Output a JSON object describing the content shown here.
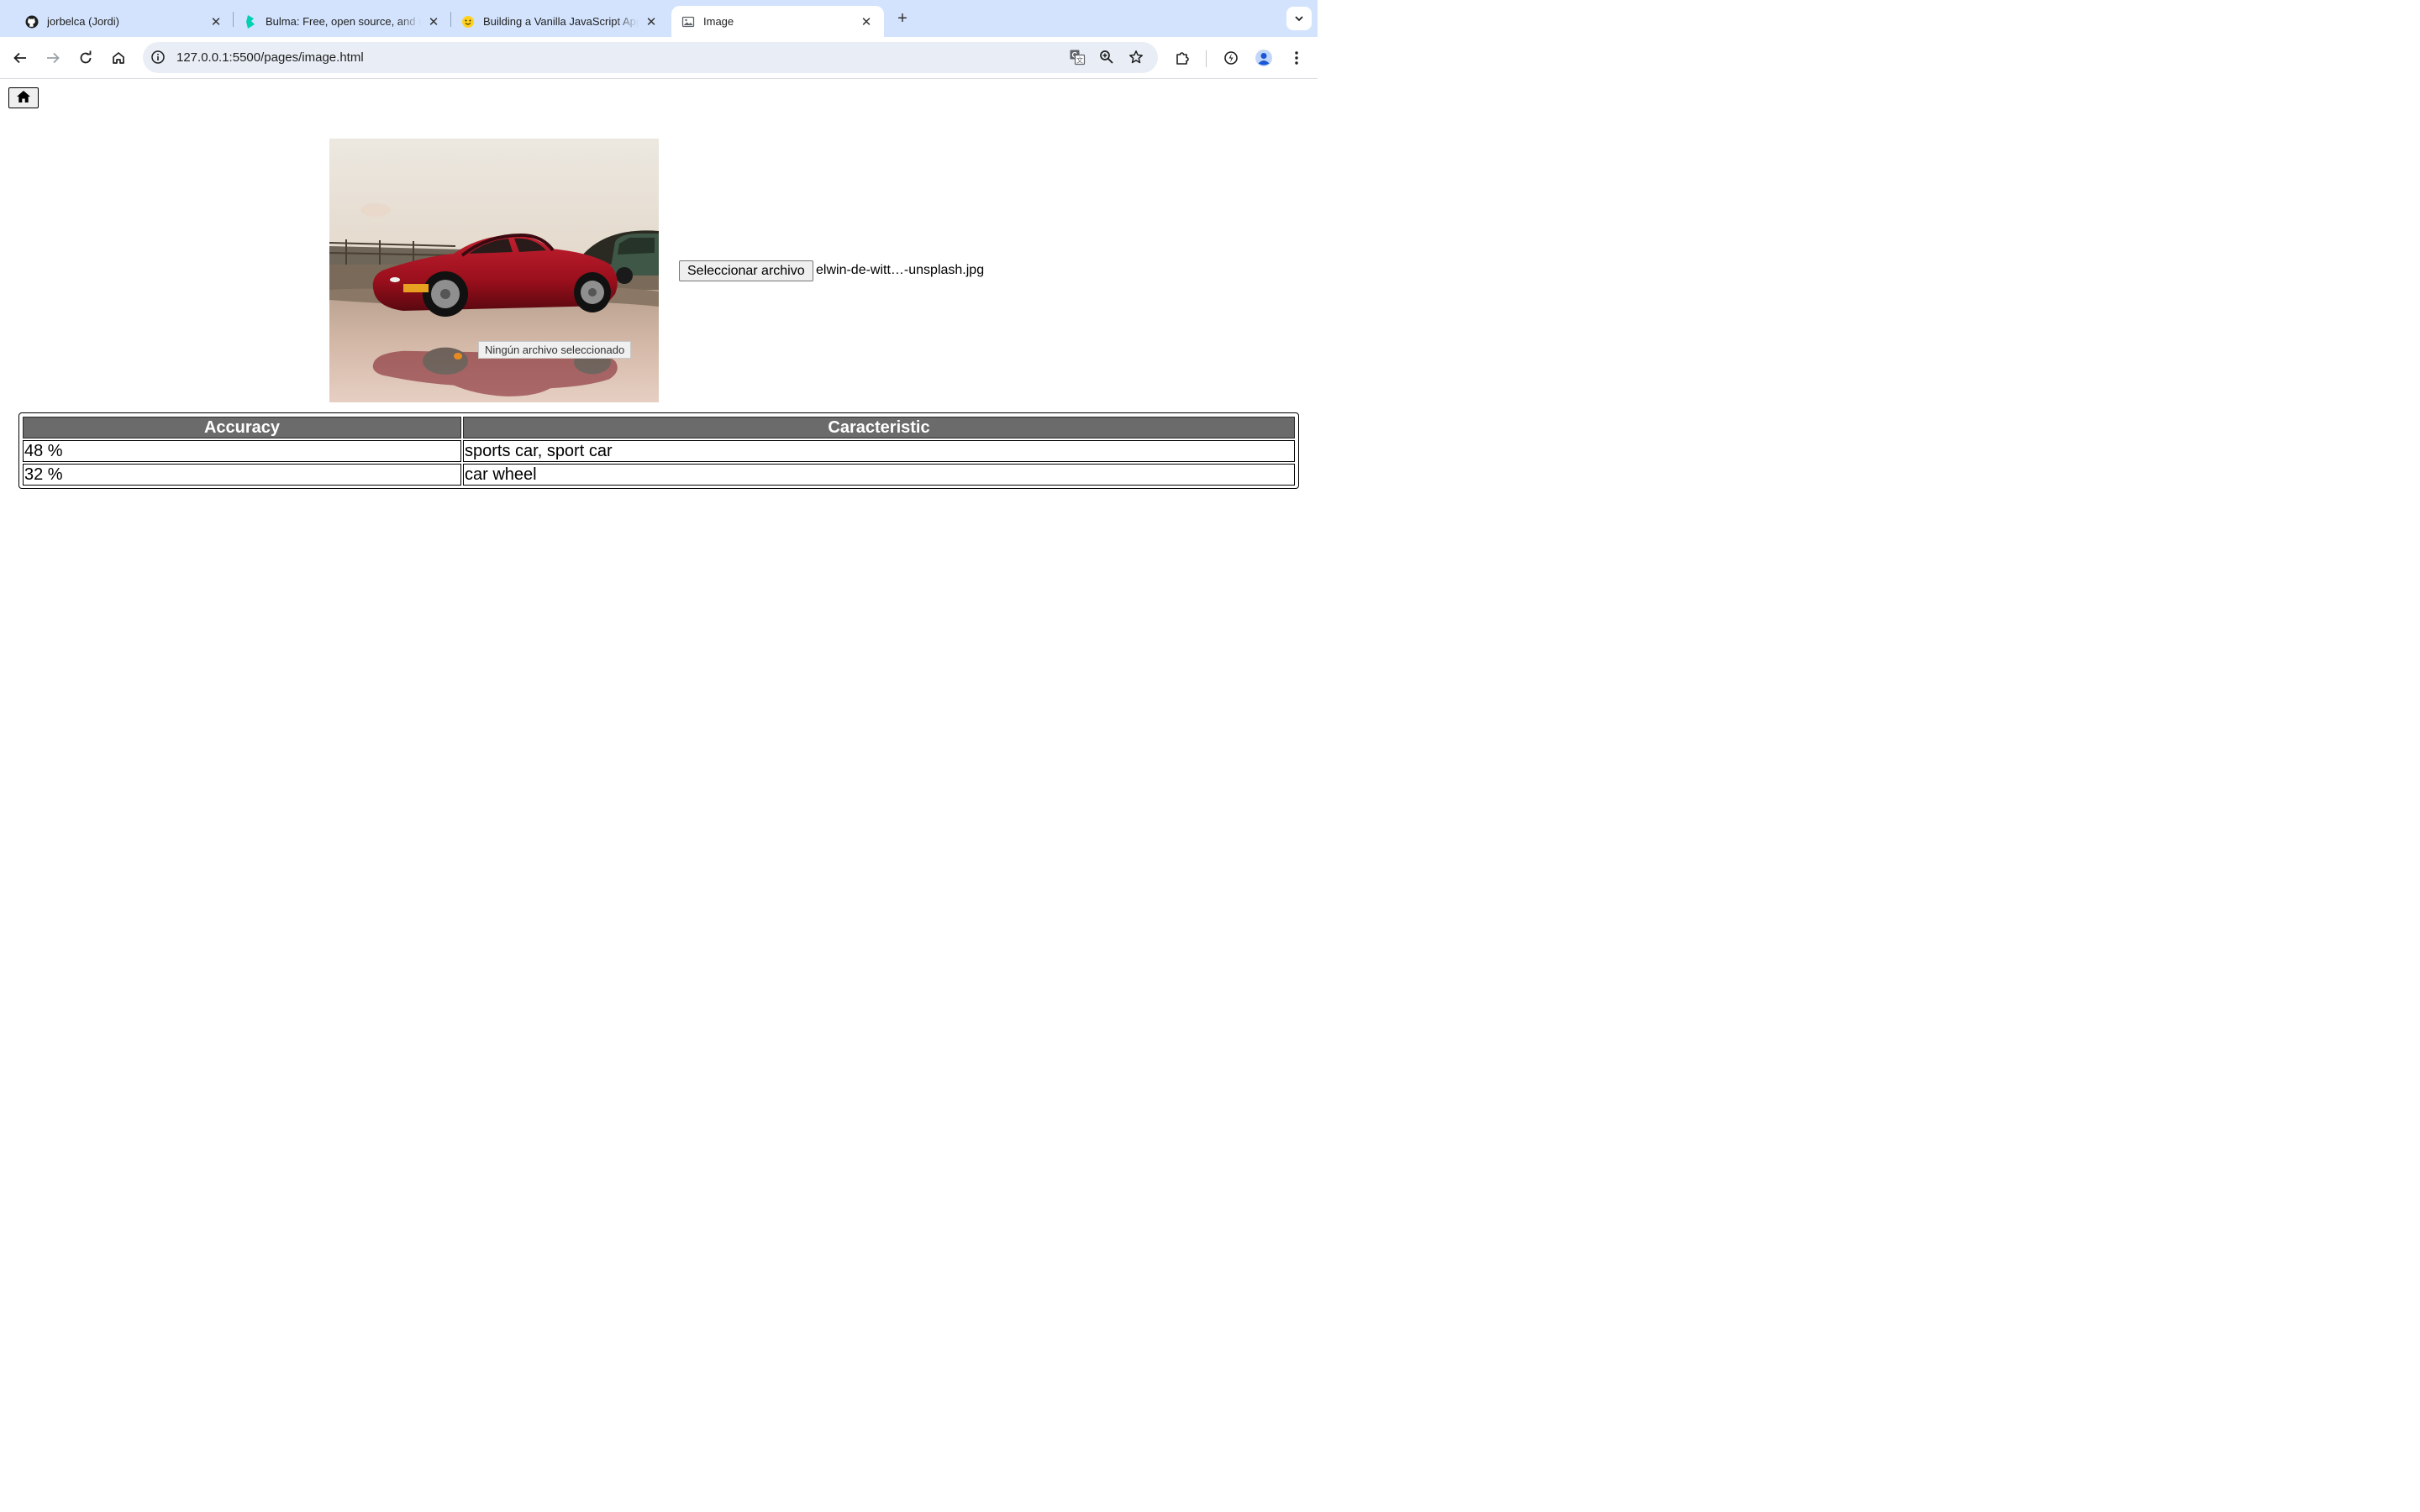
{
  "browser": {
    "tabs": [
      {
        "title": "jorbelca (Jordi)",
        "icon": "github-icon"
      },
      {
        "title": "Bulma: Free, open source, and modern CSS framework",
        "icon": "bulma-icon"
      },
      {
        "title": "Building a Vanilla JavaScript App",
        "icon": "hugging-face-icon"
      },
      {
        "title": "Image",
        "icon": "image-icon"
      }
    ],
    "url": "127.0.0.1:5500/pages/image.html"
  },
  "page": {
    "file_button_label": "Seleccionar archivo",
    "file_name": "elwin-de-witt…-unsplash.jpg",
    "tooltip": "Ningún archivo seleccionado",
    "table": {
      "headers": [
        "Accuracy",
        "Caracteristic"
      ],
      "rows": [
        {
          "accuracy": "48 %",
          "characteristic": "sports car, sport car"
        },
        {
          "accuracy": "32 %",
          "characteristic": "car wheel"
        }
      ]
    }
  },
  "colors": {
    "tab_strip": "#d3e3fd",
    "omnibox": "#e9eef6",
    "table_header": "#6b6b6b",
    "car_red": "#a3111b"
  }
}
